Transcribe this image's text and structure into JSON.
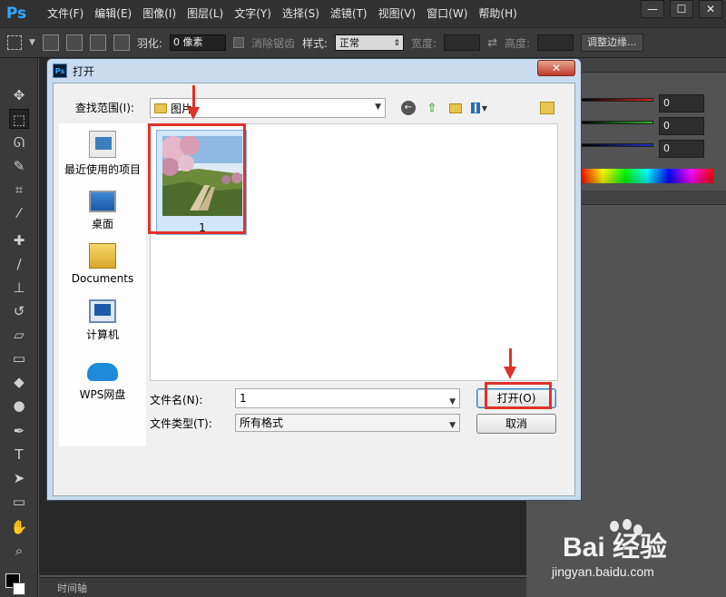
{
  "app": {
    "logo": "Ps",
    "menu": [
      "文件(F)",
      "编辑(E)",
      "图像(I)",
      "图层(L)",
      "文字(Y)",
      "选择(S)",
      "滤镜(T)",
      "视图(V)",
      "窗口(W)",
      "帮助(H)"
    ],
    "window_controls": [
      "—",
      "☐",
      "✕"
    ]
  },
  "options_bar": {
    "feather_label": "羽化:",
    "feather_value": "0 像素",
    "antialias_label": "消除锯齿",
    "style_label": "样式:",
    "style_value": "正常",
    "width_label": "宽度:",
    "height_label": "高度:",
    "refine_edge_label": "调整边缘..."
  },
  "color_panel": {
    "values": [
      "0",
      "0",
      "0"
    ],
    "colors": {
      "red": "#d4271f",
      "green": "#2fb52f",
      "blue": "#2030c8"
    }
  },
  "timeline": {
    "label": "时间轴"
  },
  "dialog": {
    "title": "打开",
    "close_label": "✕",
    "look_in_label": "查找范围(I):",
    "look_in_value": "图片",
    "places": [
      {
        "label": "最近使用的项目",
        "icon": "recent-icon"
      },
      {
        "label": "桌面",
        "icon": "desktop-icon"
      },
      {
        "label": "Documents",
        "icon": "documents-folder-icon"
      },
      {
        "label": "计算机",
        "icon": "computer-icon"
      },
      {
        "label": "WPS网盘",
        "icon": "cloud-icon"
      }
    ],
    "files": [
      {
        "name": "1",
        "selected": true
      }
    ],
    "file_name_label": "文件名(N):",
    "file_name_value": "1",
    "file_type_label": "文件类型(T):",
    "file_type_value": "所有格式",
    "open_button": "打开(O)",
    "cancel_button": "取消"
  },
  "watermark": {
    "brand": "Bai 经验",
    "url": "jingyan.baidu.com"
  }
}
